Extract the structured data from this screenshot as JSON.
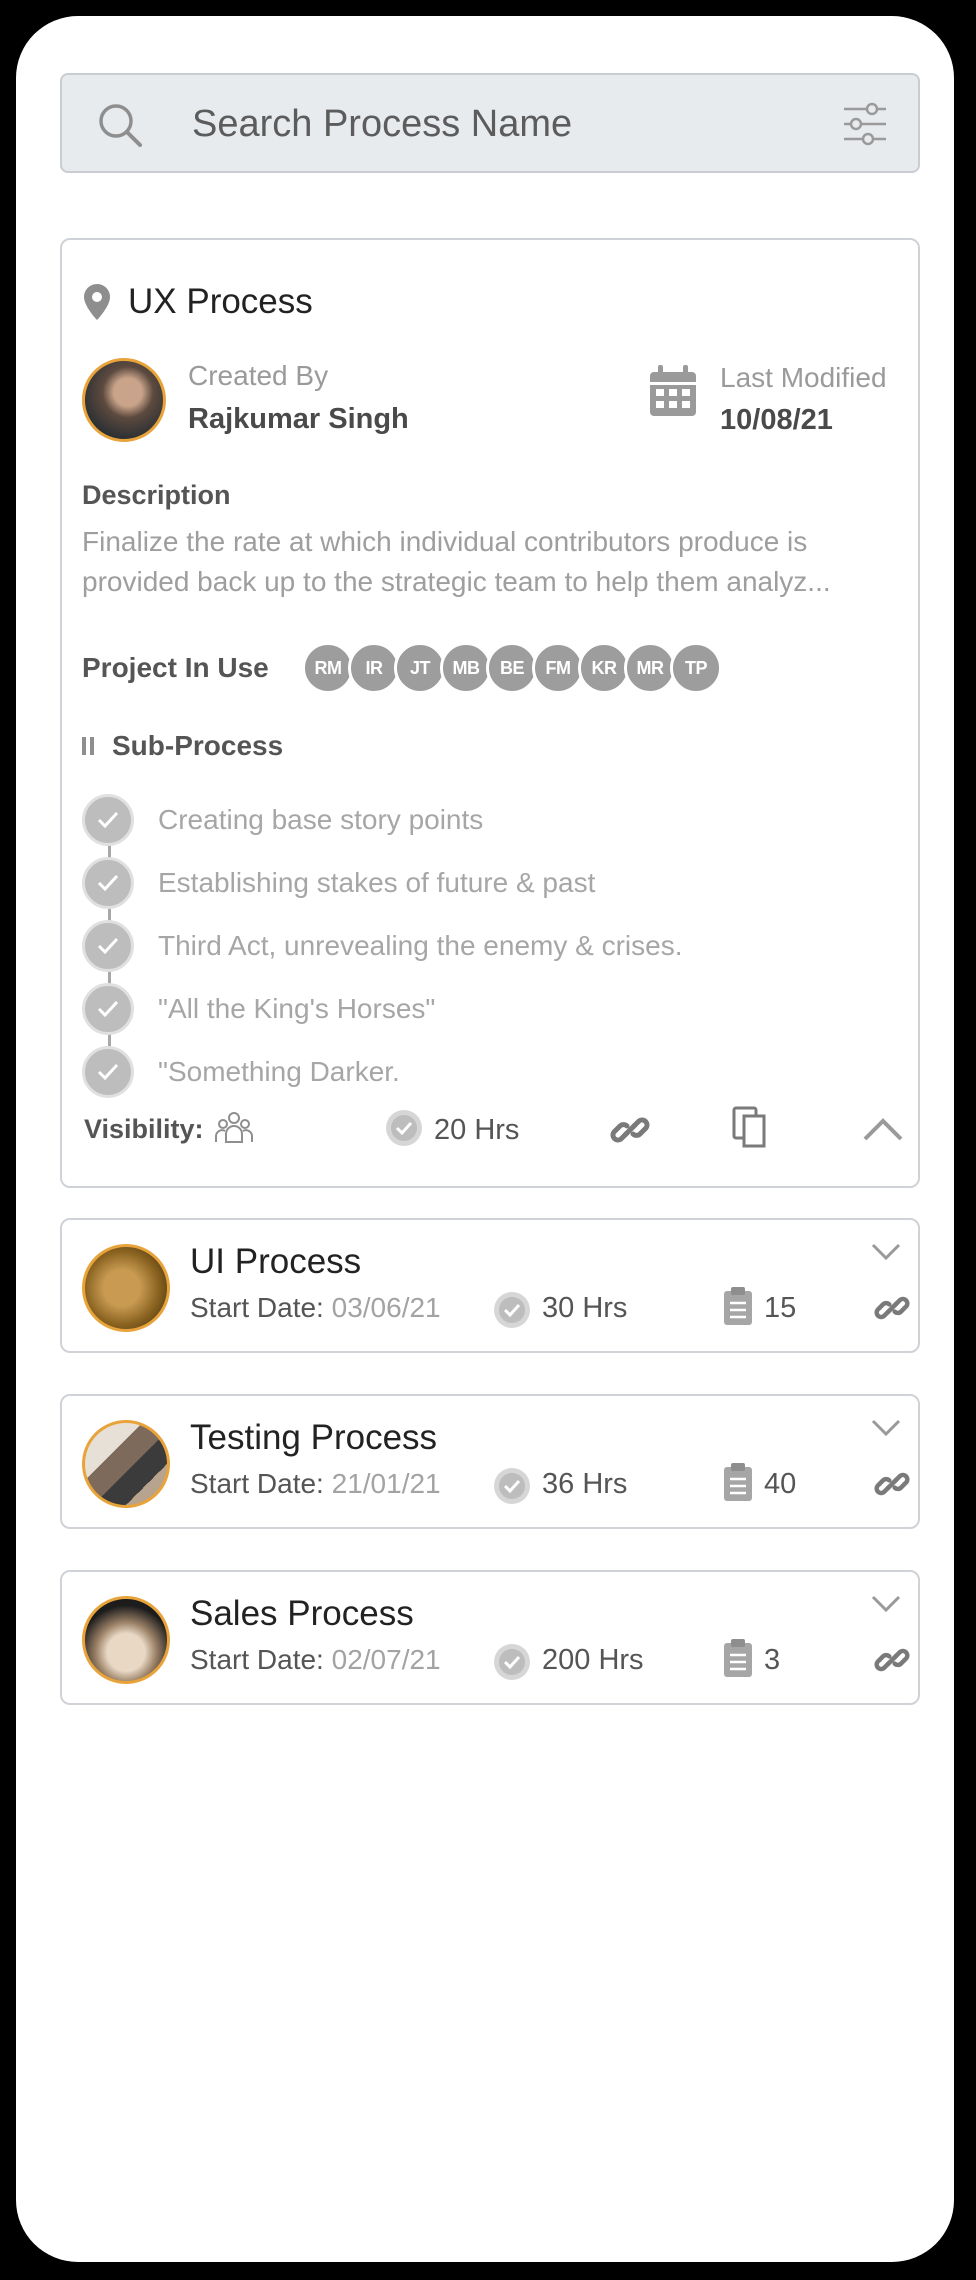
{
  "search": {
    "placeholder": "Search Process Name",
    "icons": [
      "search-icon",
      "filter-sliders-icon"
    ]
  },
  "main_card": {
    "title": "UX Process",
    "created_by_label": "Created By",
    "created_by_name": "Rajkumar Singh",
    "last_modified_label": "Last Modified",
    "last_modified_date": "10/08/21",
    "description_label": "Description",
    "description_text": "Finalize the rate at which individual contributors produce is provided back up to the strategic team to help them analyz...",
    "project_in_use_label": "Project In Use",
    "projects": [
      "RM",
      "IR",
      "JT",
      "MB",
      "BE",
      "FM",
      "KR",
      "MR",
      "TP"
    ],
    "sub_process_label": "Sub-Process",
    "sub_processes": [
      "Creating base story points",
      "Establishing stakes of future & past",
      "Third Act, unrevealing the enemy & crises.",
      "\"All the King's Horses\"",
      "\"Something Darker."
    ],
    "visibility_label": "Visibility:",
    "hours": "20 Hrs"
  },
  "processes": [
    {
      "title": "UI Process",
      "start_label": "Start Date:",
      "start_date": "03/06/21",
      "hours": "30 Hrs",
      "count": "15"
    },
    {
      "title": "Testing Process",
      "start_label": "Start Date:",
      "start_date": "21/01/21",
      "hours": "36 Hrs",
      "count": "40"
    },
    {
      "title": "Sales Process",
      "start_label": "Start Date:",
      "start_date": "02/07/21",
      "hours": "200 Hrs",
      "count": "3"
    }
  ],
  "colors": {
    "accent_avatar_border": "#e8a33a",
    "chip_grey": "#9d9d9d",
    "icon_grey": "#8e8e8e"
  }
}
